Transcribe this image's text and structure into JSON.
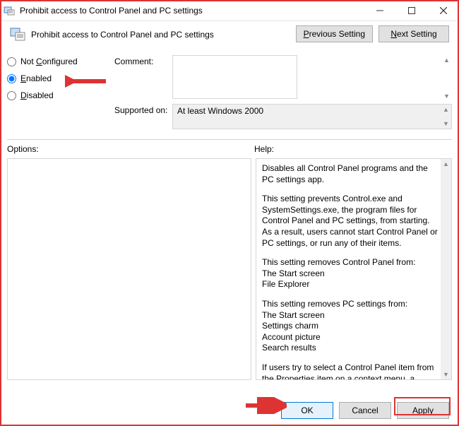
{
  "window": {
    "title": "Prohibit access to Control Panel and PC settings"
  },
  "header": {
    "title": "Prohibit access to Control Panel and PC settings",
    "prev": "Previous Setting",
    "next": "Next Setting"
  },
  "state": {
    "options": [
      {
        "id": "not-configured",
        "label_pre": "Not ",
        "ul": "C",
        "label_post": "onfigured",
        "checked": false
      },
      {
        "id": "enabled",
        "label_pre": "",
        "ul": "E",
        "label_post": "nabled",
        "checked": true
      },
      {
        "id": "disabled",
        "label_pre": "",
        "ul": "D",
        "label_post": "isabled",
        "checked": false
      }
    ]
  },
  "labels": {
    "comment": "Comment:",
    "supported": "Supported on:",
    "options": "Options:",
    "help": "Help:"
  },
  "comment_value": "",
  "supported_value": "At least Windows 2000",
  "help_text": {
    "p1": "Disables all Control Panel programs and the PC settings app.",
    "p2": "This setting prevents Control.exe and SystemSettings.exe, the program files for Control Panel and PC settings, from starting. As a result, users cannot start Control Panel or PC settings, or run any of their items.",
    "p3a": "This setting removes Control Panel from:",
    "p3b": "The Start screen",
    "p3c": "File Explorer",
    "p4a": "This setting removes PC settings from:",
    "p4b": "The Start screen",
    "p4c": "Settings charm",
    "p4d": "Account picture",
    "p4e": "Search results",
    "p5": "If users try to select a Control Panel item from the Properties item on a context menu, a message appears explaining that a setting prevents the action."
  },
  "footer": {
    "ok": "OK",
    "cancel": "Cancel",
    "apply": "Apply"
  }
}
